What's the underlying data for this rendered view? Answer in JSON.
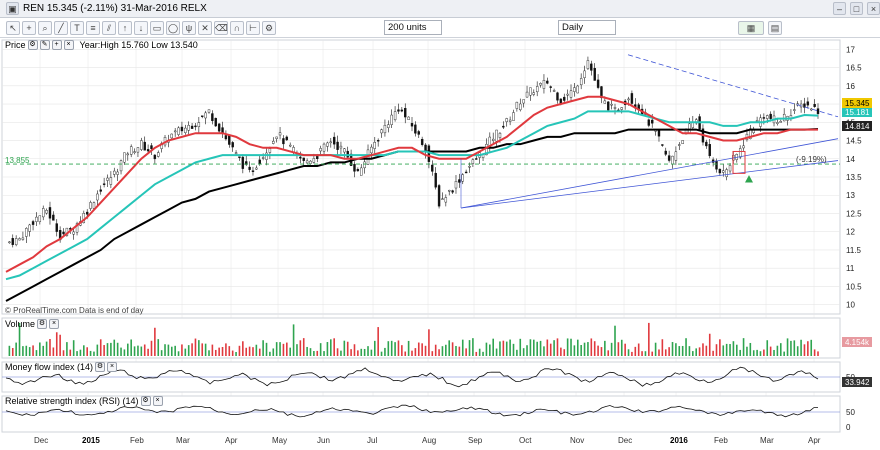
{
  "window": {
    "title": "REN  15.345 (-2.11%)  31-Mar-2016  RELX",
    "symbol": "REN"
  },
  "toolbar": {
    "units_select": "200 units",
    "period_select": "Daily"
  },
  "panels": {
    "price": {
      "label": "Price",
      "stats": "Year:High 15.760 Low 13.540",
      "watermark": "© ProRealTime.com  Data is end of day",
      "last_price_badge": "15.345",
      "ma_badge_1": "15.181",
      "ma_badge_2": "14.814",
      "hline_label": "13.855",
      "pct_label": "(-9.19%)"
    },
    "volume": {
      "label": "Volume",
      "badge": "4.154k"
    },
    "mfi": {
      "label": "Money flow index (14)",
      "badge": "33.942"
    },
    "rsi": {
      "label": "Relative strength index (RSI) (14)"
    }
  },
  "colors": {
    "up": "#2ea44f",
    "down": "#e0393e",
    "ma_short": "#e0393e",
    "ma_mid": "#26c5b8",
    "ma_long": "#000000",
    "trend": "#4056d6",
    "grid": "#e6e6e6"
  },
  "chart_data": {
    "type": "line",
    "x_ticks": [
      "Dec",
      "2015",
      "Feb",
      "Mar",
      "Apr",
      "May",
      "Jun",
      "Jul",
      "Aug",
      "Sep",
      "Oct",
      "Nov",
      "Dec",
      "2016",
      "Feb",
      "Mar",
      "Apr"
    ],
    "ylim": [
      9.8,
      17.2
    ],
    "y_ticks": [
      10,
      10.5,
      11,
      11.5,
      12,
      12.5,
      13,
      13.5,
      14,
      14.5,
      15,
      15.5,
      16,
      16.5,
      17
    ],
    "price_path": [
      11.7,
      11.8,
      12.3,
      12.6,
      11.9,
      12.1,
      12.6,
      13.2,
      13.6,
      14.2,
      14.4,
      14.1,
      14.6,
      14.8,
      15.0,
      15.3,
      14.7,
      14.1,
      13.6,
      14.1,
      14.7,
      14.3,
      13.9,
      14.1,
      14.5,
      14.2,
      13.6,
      14.3,
      14.9,
      15.4,
      14.9,
      14.3,
      12.8,
      13.2,
      13.7,
      14.1,
      14.6,
      15.0,
      15.6,
      15.9,
      16.1,
      15.6,
      15.9,
      16.7,
      15.6,
      15.3,
      15.7,
      15.3,
      14.7,
      13.9,
      14.6,
      15.1,
      14.0,
      13.6,
      14.1,
      14.8,
      15.2,
      15.0,
      15.3,
      15.5,
      15.345
    ],
    "ma_short": [
      10.9,
      11.1,
      11.3,
      11.6,
      11.8,
      12.1,
      12.4,
      12.8,
      13.2,
      13.6,
      14.0,
      14.3,
      14.5,
      14.6,
      14.7,
      14.7,
      14.7,
      14.6,
      14.4,
      14.3,
      14.3,
      14.2,
      14.1,
      14.1,
      14.1,
      14.0,
      14.0,
      14.1,
      14.2,
      14.3,
      14.3,
      14.1,
      14.0,
      14.0,
      14.0,
      14.2,
      14.4,
      14.6,
      14.9,
      15.2,
      15.4,
      15.5,
      15.6,
      15.7,
      15.7,
      15.6,
      15.5,
      15.3,
      15.1,
      14.9,
      14.7,
      14.7,
      14.6,
      14.5,
      14.5,
      14.6,
      14.7,
      14.7,
      14.8,
      14.8,
      14.8
    ],
    "ma_mid": [
      10.7,
      10.8,
      11.0,
      11.2,
      11.4,
      11.6,
      11.8,
      12.1,
      12.4,
      12.7,
      13.0,
      13.3,
      13.5,
      13.7,
      13.9,
      14.0,
      14.1,
      14.1,
      14.1,
      14.1,
      14.1,
      14.1,
      14.1,
      14.1,
      14.1,
      14.1,
      14.1,
      14.1,
      14.1,
      14.2,
      14.2,
      14.2,
      14.1,
      14.1,
      14.1,
      14.1,
      14.2,
      14.3,
      14.5,
      14.7,
      14.9,
      15.0,
      15.1,
      15.3,
      15.3,
      15.3,
      15.3,
      15.2,
      15.1,
      15.0,
      15.0,
      15.0,
      15.0,
      14.9,
      14.9,
      15.0,
      15.0,
      15.1,
      15.1,
      15.2,
      15.181
    ],
    "ma_long": [
      10.1,
      10.3,
      10.5,
      10.7,
      10.9,
      11.1,
      11.3,
      11.5,
      11.8,
      12.0,
      12.2,
      12.4,
      12.6,
      12.8,
      12.9,
      13.1,
      13.2,
      13.3,
      13.4,
      13.5,
      13.6,
      13.7,
      13.8,
      13.8,
      13.9,
      13.9,
      14.0,
      14.0,
      14.1,
      14.2,
      14.2,
      14.2,
      14.2,
      14.2,
      14.2,
      14.3,
      14.3,
      14.4,
      14.4,
      14.5,
      14.6,
      14.6,
      14.7,
      14.7,
      14.7,
      14.7,
      14.8,
      14.8,
      14.8,
      14.8,
      14.8,
      14.8,
      14.7,
      14.7,
      14.7,
      14.8,
      14.8,
      14.8,
      14.8,
      14.8,
      14.814
    ],
    "volume_ylim": [
      0,
      1
    ],
    "mfi_ticks": [
      50
    ],
    "rsi_ticks": [
      50,
      0
    ]
  }
}
